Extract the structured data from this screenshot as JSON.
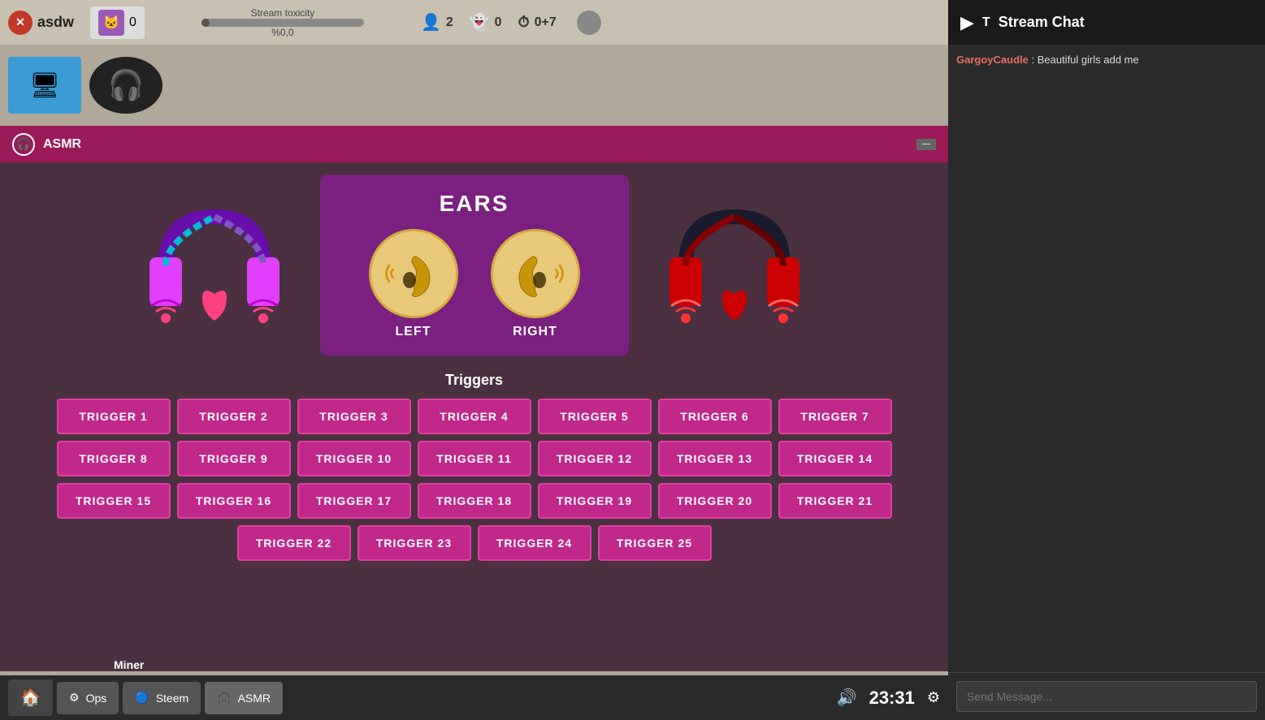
{
  "topBar": {
    "appName": "asdw",
    "catCount": "0",
    "toxicityLabel": "Stream toxicity",
    "toxicityPct": "%0,0",
    "toxicityBarWidth": "5",
    "viewers": "2",
    "ghosts": "0",
    "timer": "0+7"
  },
  "streamChat": {
    "playIcon": "▶",
    "tLabel": "T",
    "title": "Stream Chat"
  },
  "asmrPanel": {
    "title": "ASMR",
    "minimizeLabel": "—",
    "earsTitle": "EARS",
    "leftEarLabel": "LEFT",
    "rightEarLabel": "RIGHT",
    "triggersTitle": "Triggers",
    "triggers": [
      "TRIGGER 1",
      "TRIGGER 2",
      "TRIGGER 3",
      "TRIGGER 4",
      "TRIGGER 5",
      "TRIGGER 6",
      "TRIGGER 7",
      "TRIGGER 8",
      "TRIGGER 9",
      "TRIGGER 10",
      "TRIGGER 11",
      "TRIGGER 12",
      "TRIGGER 13",
      "TRIGGER 14",
      "TRIGGER 15",
      "TRIGGER 16",
      "TRIGGER 17",
      "TRIGGER 18",
      "TRIGGER 19",
      "TRIGGER 20",
      "TRIGGER 21",
      "TRIGGER 22",
      "TRIGGER 23",
      "TRIGGER 24",
      "TRIGGER 25"
    ]
  },
  "bottomBar": {
    "opsLabel": "Ops",
    "steemLabel": "Steem",
    "asmrLabel": "ASMR",
    "minerLabel": "Miner",
    "clock": "23:31"
  },
  "chat": {
    "messages": [
      {
        "username": "GargoyCaudle",
        "text": ": Beautiful girls add me"
      }
    ],
    "inputPlaceholder": "Send Message..."
  }
}
